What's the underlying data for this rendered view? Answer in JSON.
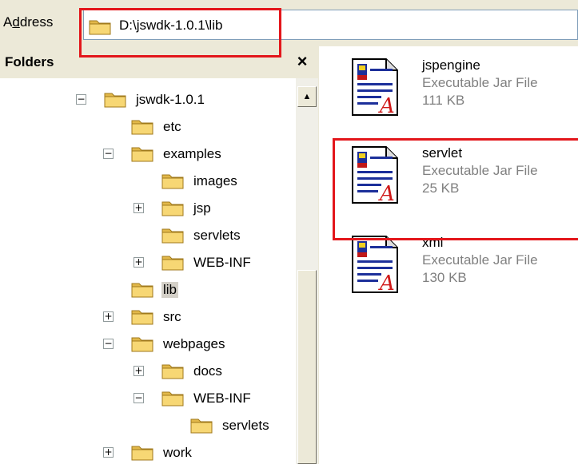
{
  "address": {
    "label_pre": "A",
    "label_underlined": "d",
    "label_post": "dress",
    "path": "D:\\jswdk-1.0.1\\lib"
  },
  "folders": {
    "title": "Folders",
    "close": "×"
  },
  "tree": [
    {
      "label": "jswdk-1.0.1",
      "expander": "−"
    },
    {
      "label": "etc",
      "expander": ""
    },
    {
      "label": "examples",
      "expander": "−"
    },
    {
      "label": "images",
      "expander": ""
    },
    {
      "label": "jsp",
      "expander": "+"
    },
    {
      "label": "servlets",
      "expander": ""
    },
    {
      "label": "WEB-INF",
      "expander": "+"
    },
    {
      "label": "lib",
      "expander": "",
      "selected": true
    },
    {
      "label": "src",
      "expander": "+"
    },
    {
      "label": "webpages",
      "expander": "−"
    },
    {
      "label": "docs",
      "expander": "+"
    },
    {
      "label": "WEB-INF",
      "expander": "−"
    },
    {
      "label": "servlets",
      "expander": ""
    },
    {
      "label": "work",
      "expander": "+"
    }
  ],
  "files": [
    {
      "name": "jspengine",
      "type": "Executable Jar File",
      "size": "111 KB"
    },
    {
      "name": "servlet",
      "type": "Executable Jar File",
      "size": "25 KB"
    },
    {
      "name": "xml",
      "type": "Executable Jar File",
      "size": "130 KB"
    }
  ],
  "colors": {
    "highlight": "#e3161b",
    "folder": "#f7d774"
  }
}
